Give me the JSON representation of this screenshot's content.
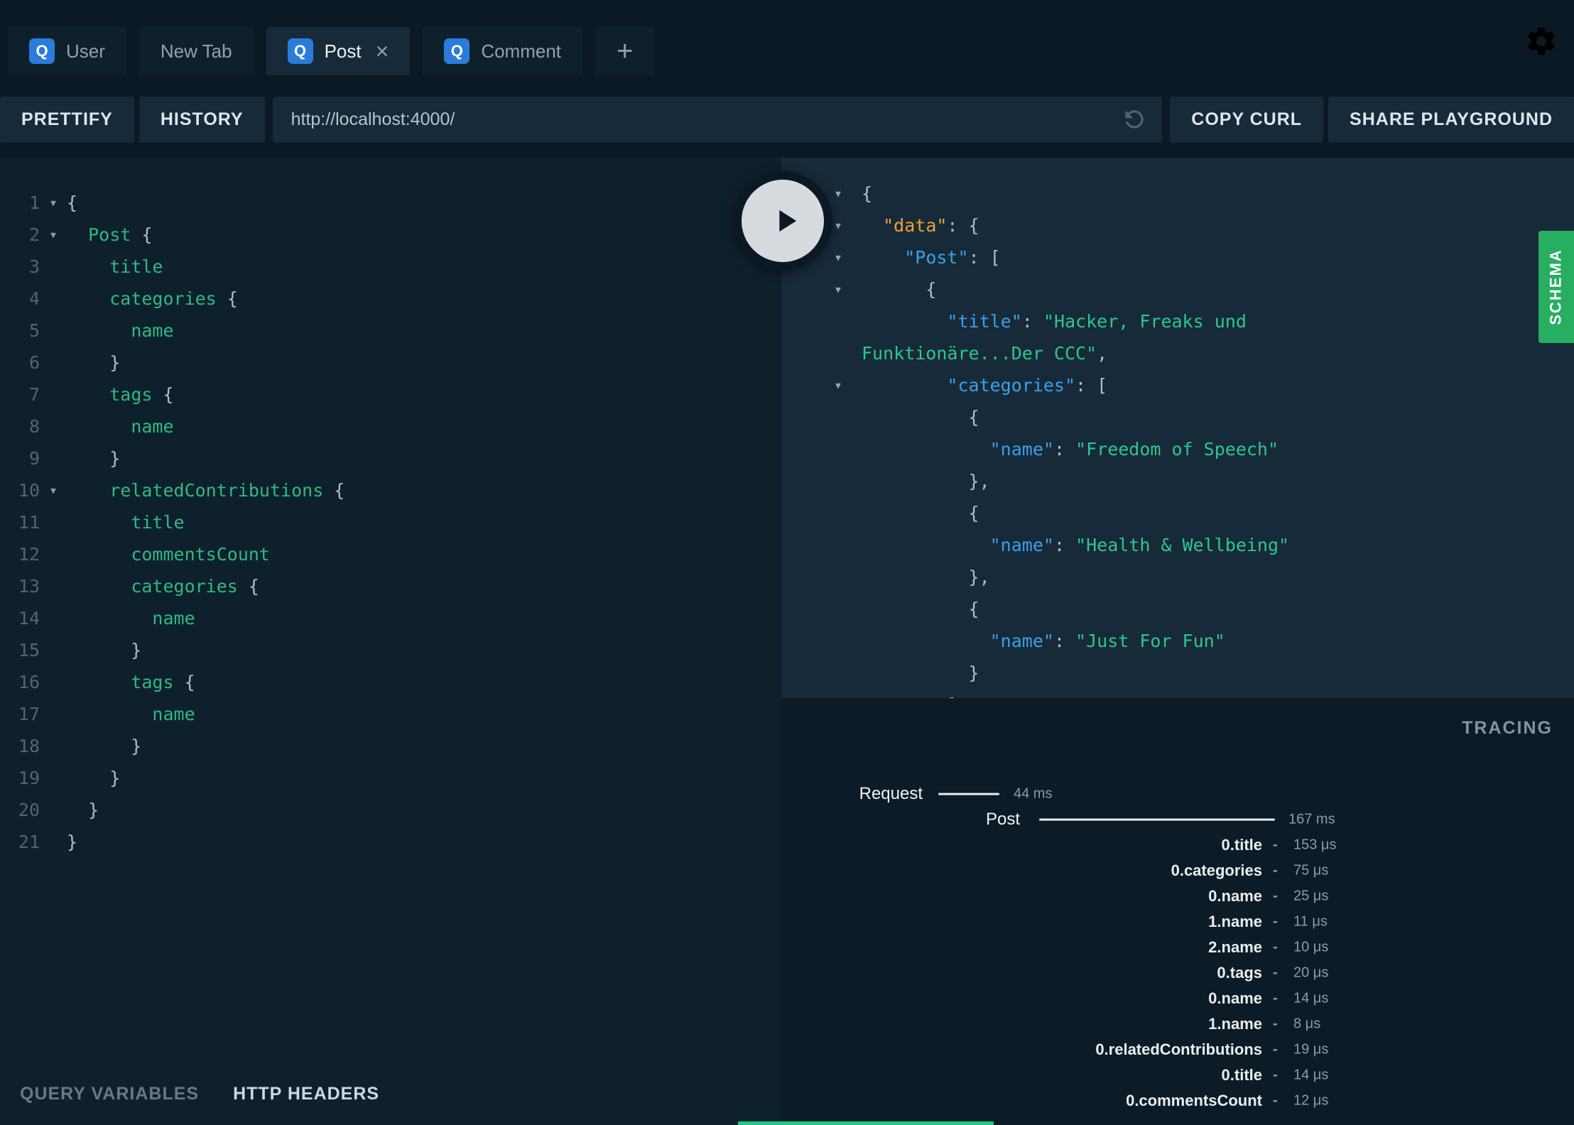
{
  "tabs": {
    "items": [
      {
        "label": "User",
        "badge": "Q",
        "active": false,
        "closable": false
      },
      {
        "label": "New Tab",
        "badge": "",
        "active": false,
        "closable": false
      },
      {
        "label": "Post",
        "badge": "Q",
        "active": true,
        "closable": true
      },
      {
        "label": "Comment",
        "badge": "Q",
        "active": false,
        "closable": false
      }
    ],
    "add_tab": "+",
    "close_glyph": "×"
  },
  "toolbar": {
    "prettify": "PRETTIFY",
    "history": "HISTORY",
    "url": "http://localhost:4000/",
    "copy_curl": "COPY CURL",
    "share": "SHARE PLAYGROUND"
  },
  "editor": {
    "lines": [
      {
        "fold": true,
        "tokens": [
          [
            "{",
            "pun"
          ]
        ]
      },
      {
        "fold": true,
        "tokens": [
          [
            "  ",
            "pln"
          ],
          [
            "Post",
            "fld"
          ],
          [
            " {",
            "pun"
          ]
        ]
      },
      {
        "fold": false,
        "tokens": [
          [
            "    ",
            "pln"
          ],
          [
            "title",
            "fld"
          ]
        ]
      },
      {
        "fold": false,
        "tokens": [
          [
            "    ",
            "pln"
          ],
          [
            "categories",
            "fld"
          ],
          [
            " {",
            "pun"
          ]
        ]
      },
      {
        "fold": false,
        "tokens": [
          [
            "      ",
            "pln"
          ],
          [
            "name",
            "fld"
          ]
        ]
      },
      {
        "fold": false,
        "tokens": [
          [
            "    }",
            "pun"
          ]
        ]
      },
      {
        "fold": false,
        "tokens": [
          [
            "    ",
            "pln"
          ],
          [
            "tags",
            "fld"
          ],
          [
            " {",
            "pun"
          ]
        ]
      },
      {
        "fold": false,
        "tokens": [
          [
            "      ",
            "pln"
          ],
          [
            "name",
            "fld"
          ]
        ]
      },
      {
        "fold": false,
        "tokens": [
          [
            "    }",
            "pun"
          ]
        ]
      },
      {
        "fold": true,
        "tokens": [
          [
            "    ",
            "pln"
          ],
          [
            "relatedContributions",
            "fld"
          ],
          [
            " {",
            "pun"
          ]
        ]
      },
      {
        "fold": false,
        "tokens": [
          [
            "      ",
            "pln"
          ],
          [
            "title",
            "fld"
          ]
        ]
      },
      {
        "fold": false,
        "tokens": [
          [
            "      ",
            "pln"
          ],
          [
            "commentsCount",
            "fld"
          ]
        ]
      },
      {
        "fold": false,
        "tokens": [
          [
            "      ",
            "pln"
          ],
          [
            "categories",
            "fld"
          ],
          [
            " {",
            "pun"
          ]
        ]
      },
      {
        "fold": false,
        "tokens": [
          [
            "        ",
            "pln"
          ],
          [
            "name",
            "fld"
          ]
        ]
      },
      {
        "fold": false,
        "tokens": [
          [
            "      }",
            "pun"
          ]
        ]
      },
      {
        "fold": false,
        "tokens": [
          [
            "      ",
            "pln"
          ],
          [
            "tags",
            "fld"
          ],
          [
            " {",
            "pun"
          ]
        ]
      },
      {
        "fold": false,
        "tokens": [
          [
            "        ",
            "pln"
          ],
          [
            "name",
            "fld"
          ]
        ]
      },
      {
        "fold": false,
        "tokens": [
          [
            "      }",
            "pun"
          ]
        ]
      },
      {
        "fold": false,
        "tokens": [
          [
            "    }",
            "pun"
          ]
        ]
      },
      {
        "fold": false,
        "tokens": [
          [
            "  }",
            "pun"
          ]
        ]
      },
      {
        "fold": false,
        "tokens": [
          [
            "}",
            "pun"
          ]
        ]
      }
    ]
  },
  "results": {
    "lines": [
      {
        "fold": true,
        "tokens": [
          [
            "{",
            "pun"
          ]
        ]
      },
      {
        "fold": true,
        "tokens": [
          [
            "  ",
            "pln"
          ],
          [
            "\"data\"",
            "dat"
          ],
          [
            ": {",
            "pun"
          ]
        ]
      },
      {
        "fold": true,
        "tokens": [
          [
            "    ",
            "pln"
          ],
          [
            "\"Post\"",
            "key"
          ],
          [
            ": [",
            "pun"
          ]
        ]
      },
      {
        "fold": true,
        "tokens": [
          [
            "      {",
            "pun"
          ]
        ]
      },
      {
        "fold": false,
        "tokens": [
          [
            "        ",
            "pln"
          ],
          [
            "\"title\"",
            "key"
          ],
          [
            ": ",
            "pun"
          ],
          [
            "\"Hacker, Freaks und",
            "str"
          ]
        ]
      },
      {
        "fold": false,
        "tokens": [
          [
            "Funktionäre...Der CCC\"",
            "str"
          ],
          [
            ",",
            "pun"
          ]
        ]
      },
      {
        "fold": true,
        "tokens": [
          [
            "        ",
            "pln"
          ],
          [
            "\"categories\"",
            "key"
          ],
          [
            ": [",
            "pun"
          ]
        ]
      },
      {
        "fold": false,
        "tokens": [
          [
            "          {",
            "pun"
          ]
        ]
      },
      {
        "fold": false,
        "tokens": [
          [
            "            ",
            "pln"
          ],
          [
            "\"name\"",
            "key"
          ],
          [
            ": ",
            "pun"
          ],
          [
            "\"Freedom of Speech\"",
            "str"
          ]
        ]
      },
      {
        "fold": false,
        "tokens": [
          [
            "          },",
            "pun"
          ]
        ]
      },
      {
        "fold": false,
        "tokens": [
          [
            "          {",
            "pun"
          ]
        ]
      },
      {
        "fold": false,
        "tokens": [
          [
            "            ",
            "pln"
          ],
          [
            "\"name\"",
            "key"
          ],
          [
            ": ",
            "pun"
          ],
          [
            "\"Health & Wellbeing\"",
            "str"
          ]
        ]
      },
      {
        "fold": false,
        "tokens": [
          [
            "          },",
            "pun"
          ]
        ]
      },
      {
        "fold": false,
        "tokens": [
          [
            "          {",
            "pun"
          ]
        ]
      },
      {
        "fold": false,
        "tokens": [
          [
            "            ",
            "pln"
          ],
          [
            "\"name\"",
            "key"
          ],
          [
            ": ",
            "pun"
          ],
          [
            "\"Just For Fun\"",
            "str"
          ]
        ]
      },
      {
        "fold": false,
        "tokens": [
          [
            "          }",
            "pun"
          ]
        ]
      },
      {
        "fold": false,
        "tokens": [
          [
            "        ]",
            "pun"
          ]
        ]
      }
    ]
  },
  "schema_tab": {
    "label": "SCHEMA"
  },
  "tracing": {
    "title": "TRACING",
    "rows": [
      {
        "label": "Request",
        "time": "44 ms",
        "kind": "bar"
      },
      {
        "label": "Post",
        "time": "167 ms",
        "kind": "bar"
      },
      {
        "label": "0.title",
        "time": "153 μs",
        "kind": "field"
      },
      {
        "label": "0.categories",
        "time": "75 μs",
        "kind": "field"
      },
      {
        "label": "0.name",
        "time": "25 μs",
        "kind": "field"
      },
      {
        "label": "1.name",
        "time": "11 μs",
        "kind": "field"
      },
      {
        "label": "2.name",
        "time": "10 μs",
        "kind": "field"
      },
      {
        "label": "0.tags",
        "time": "20 μs",
        "kind": "field"
      },
      {
        "label": "0.name",
        "time": "14 μs",
        "kind": "field"
      },
      {
        "label": "1.name",
        "time": "8 μs",
        "kind": "field"
      },
      {
        "label": "0.relatedContributions",
        "time": "19 μs",
        "kind": "field"
      },
      {
        "label": "0.title",
        "time": "14 μs",
        "kind": "field"
      },
      {
        "label": "0.commentsCount",
        "time": "12 μs",
        "kind": "field"
      }
    ]
  },
  "footer": {
    "query_variables": "QUERY VARIABLES",
    "http_headers": "HTTP HEADERS"
  },
  "colors": {
    "accent_green": "#27ae60",
    "badge_blue": "#2b7cd9",
    "key_blue": "#3aa0e8",
    "data_orange": "#f0a12e",
    "string_green": "#2ec68f",
    "field_green": "#2fb884"
  }
}
